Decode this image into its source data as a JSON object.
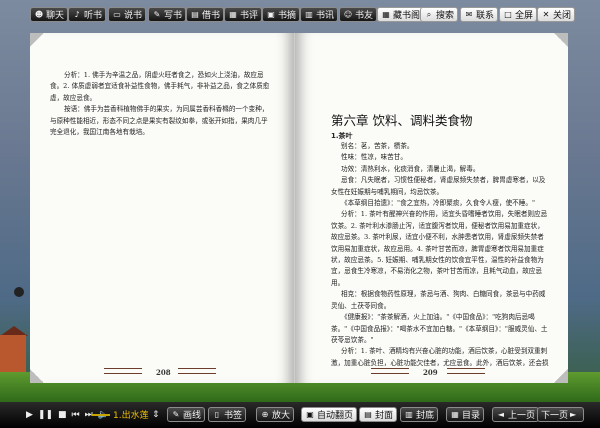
{
  "toolbar": {
    "buttons": [
      "聊天",
      "听书",
      "说书",
      "写书",
      "借书",
      "书评",
      "书摘",
      "书讯",
      "书友",
      "藏书阁",
      "搜索",
      "联系",
      "全屏",
      "关闭"
    ]
  },
  "left_page": {
    "paragraphs": [
      "分析：1. 佛手为辛温之品，阴虚火旺者食之，恐如火上浇油，故应忌食。2. 体质虚弱者宜适食补益性食物，佛手耗气，非补益之品，食之体质愈虚，故应忌食。",
      "按语：佛手为芸香科植物佛手的果实，为同属芸香科香橼的一个变种，与原种性能相近，形态不同之点是果实有裂纹如拳，或张开如指，果肉几乎完全退化，我国江南各地有栽培。"
    ],
    "page_number": "208"
  },
  "right_page": {
    "chapter_title": "第六章 饮料、调料类食物",
    "section_title": "1.茶叶",
    "paragraphs": [
      "别名：茗，苦茶，槚茶。",
      "性味：性凉，味苦甘。",
      "功效：清热利水，化痰消食，清暑止渴，解毒。",
      "忌食：凡失眠者，习惯性便秘者，肾虚尿频失禁者，脾胃虚寒者，以及女性在妊娠期与哺乳期间，均忌饮茶。",
      "《本草纲目拾遗》：\"食之宜热，冷即聚痰，久食令人瘦，使不睡。\"",
      "分析：1. 茶叶有醒神兴奋的作用，适宜头昏嗜睡者饮用，失眠者则应忌饮茶。2. 茶叶利水渗肠止泻，适宜腹泻者饮用，便秘者饮用易加重症状，故应忌茶。3. 茶叶利尿，适宜小便不利，水肿患者饮用，肾虚尿频失禁者饮用易加重症状，故应忌用。4. 茶叶甘苦而凉，脾胃虚寒者饮用易加重症状，故应忌茶。5. 妊娠期、哺乳期女性的饮食宜平性，温性的补益食物为宜，忌食生冷寒凉，不易消化之物，茶叶甘苦而凉，且耗气动血，故应忌用。",
      "相克：根据食物药性原理，茶忌与酒、狗肉、白糖同食，茶忌与中药威灵仙、土茯苓同食。",
      "《健康报》：\"茶茶解酒，火上加油。\"《中国食品》：\"吃狗肉后忌喝茶。\"《中国食品报》：\"喝茶水不宜加白糖。\"《本草纲目》：\"服威灵仙、土茯苓忌饮茶。\"",
      "分析：1. 茶叶、酒精均有兴奋心脏的功能，酒后饮茶，心脏受到双重刺激，加重心脏负担，心脏功能欠佳者，尤应忌食。此外，酒后饮茶，还会损害肾脏功能，故不相宜。2. 狗肉中的蛋白质与茶叶中的鞣酸可凝结为鞣"
    ],
    "page_number": "209"
  },
  "player": {
    "track": "1.出水莲"
  },
  "bottom": {
    "buttons": [
      "画线",
      "书签",
      "放大",
      "自动翻页",
      "封面",
      "封底",
      "目录",
      "上一页",
      "下一页"
    ]
  }
}
